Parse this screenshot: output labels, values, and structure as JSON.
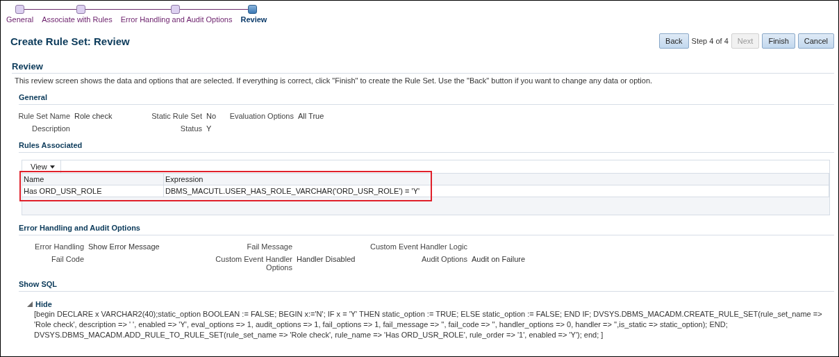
{
  "train": [
    {
      "label": "General",
      "selected": false
    },
    {
      "label": "Associate with Rules",
      "selected": false
    },
    {
      "label": "Error Handling and Audit Options",
      "selected": false
    },
    {
      "label": "Review",
      "selected": true
    }
  ],
  "page_title": "Create Rule Set: Review",
  "nav": {
    "back": "Back",
    "step": "Step 4 of 4",
    "next": {
      "label": "Next",
      "disabled": true
    },
    "finish": "Finish",
    "cancel": "Cancel"
  },
  "review": {
    "heading": "Review",
    "intro": "This review screen shows the data and options that are selected. If everything is correct, click \"Finish\" to create the Rule Set. Use the \"Back\" button if you want to change any data or option."
  },
  "general": {
    "heading": "General",
    "rows": [
      [
        {
          "label": "Rule Set Name",
          "value": "Role check"
        },
        {
          "label": "Static Rule Set",
          "value": "No"
        },
        {
          "label": "Evaluation Options",
          "value": "All True"
        }
      ],
      [
        {
          "label": "Description"
        },
        {
          "label": "Status",
          "value": "Y"
        },
        null
      ]
    ]
  },
  "rules": {
    "heading": "Rules Associated",
    "view_menu": "View",
    "highlighted": true,
    "columns": [
      "Name",
      "Expression"
    ],
    "rows": [
      [
        "Has ORD_USR_ROLE",
        "DBMS_MACUTL.USER_HAS_ROLE_VARCHAR('ORD_USR_ROLE') = 'Y'"
      ]
    ]
  },
  "error_handling": {
    "heading": "Error Handling and Audit Options",
    "rows": [
      [
        {
          "label": "Error Handling",
          "value": "Show Error Message"
        },
        {
          "label": "Fail Message"
        },
        {
          "label": "Custom Event Handler Logic"
        }
      ],
      [
        {
          "label": "Fail Code"
        },
        {
          "label": "Custom Event Handler Options",
          "value": "Handler Disabled"
        },
        {
          "label": "Audit Options",
          "value": "Audit on Failure"
        }
      ]
    ]
  },
  "sql": {
    "heading": "Show SQL",
    "toggle": "Hide",
    "expanded": true,
    "text": "[begin DECLARE x VARCHAR2(40);static_option BOOLEAN := FALSE; BEGIN x:='N'; IF x = 'Y' THEN static_option := TRUE; ELSE static_option := FALSE; END IF; DVSYS.DBMS_MACADM.CREATE_RULE_SET(rule_set_name => 'Role check', description => ' ', enabled => 'Y', eval_options => 1, audit_options => 1, fail_options => 1, fail_message => '', fail_code => '', handler_options => 0, handler => '',is_static => static_option); END; DVSYS.DBMS_MACADM.ADD_RULE_TO_RULE_SET(rule_set_name => 'Role check', rule_name => 'Has ORD_USR_ROLE', rule_order => '1', enabled => 'Y'); end; ]"
  }
}
